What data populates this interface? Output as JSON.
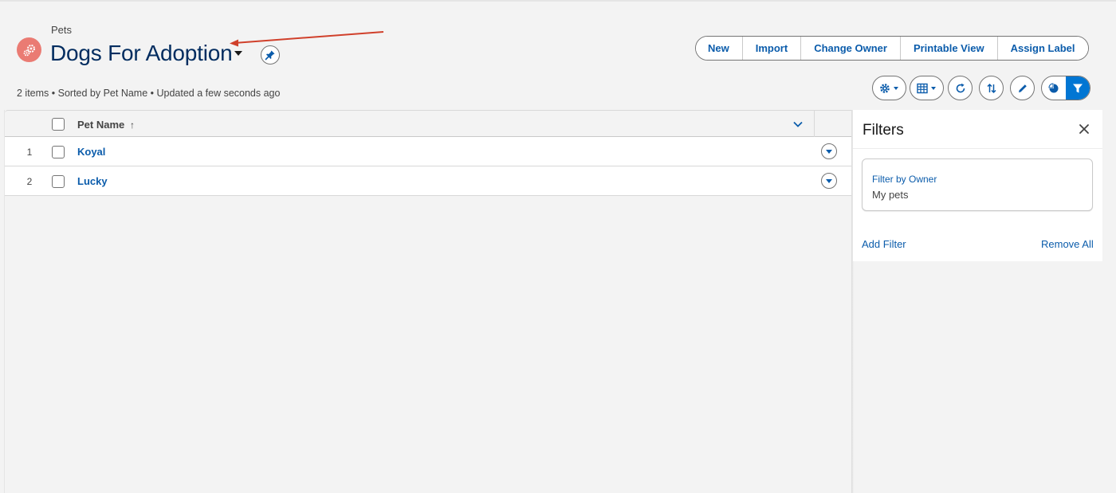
{
  "header": {
    "object_label": "Pets",
    "list_title": "Dogs For Adoption",
    "meta": "2 items • Sorted by Pet Name • Updated a few seconds ago"
  },
  "actions": {
    "new": "New",
    "import": "Import",
    "change_owner": "Change Owner",
    "printable_view": "Printable View",
    "assign_label": "Assign Label"
  },
  "toolbar_icons": [
    "gear-icon",
    "table-icon",
    "refresh-icon",
    "sort-icon",
    "pencil-icon",
    "chart-icon",
    "filter-icon"
  ],
  "table": {
    "column": "Pet Name",
    "sort_indicator": "↑",
    "rows": [
      {
        "num": "1",
        "name": "Koyal"
      },
      {
        "num": "2",
        "name": "Lucky"
      }
    ]
  },
  "filters": {
    "title": "Filters",
    "card_label": "Filter by Owner",
    "card_value": "My pets",
    "add_filter": "Add Filter",
    "remove_all": "Remove All"
  },
  "colors": {
    "brand_blue": "#0176d3",
    "link_blue": "#0b5cab",
    "title_navy": "#032d60",
    "object_icon": "#ea7b73",
    "annotation_arrow": "#d0402b"
  }
}
